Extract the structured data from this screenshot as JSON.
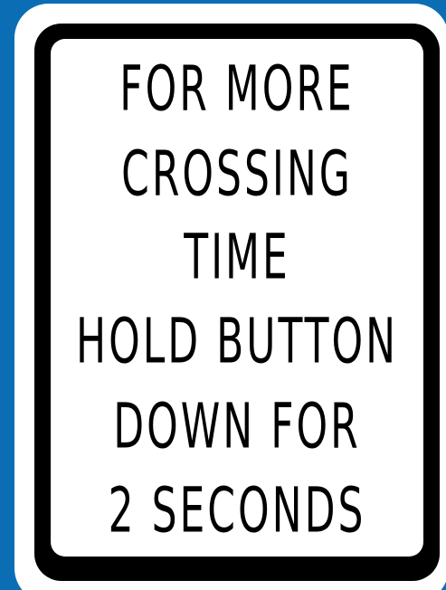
{
  "sign": {
    "lines": [
      "FOR MORE",
      "CROSSING",
      "TIME",
      "HOLD BUTTON",
      "DOWN FOR",
      "2 SECONDS"
    ]
  },
  "colors": {
    "background": "#0b6eb5",
    "outer_panel": "#ffffff",
    "border": "#000000",
    "face": "#ffffff",
    "text": "#000000"
  }
}
